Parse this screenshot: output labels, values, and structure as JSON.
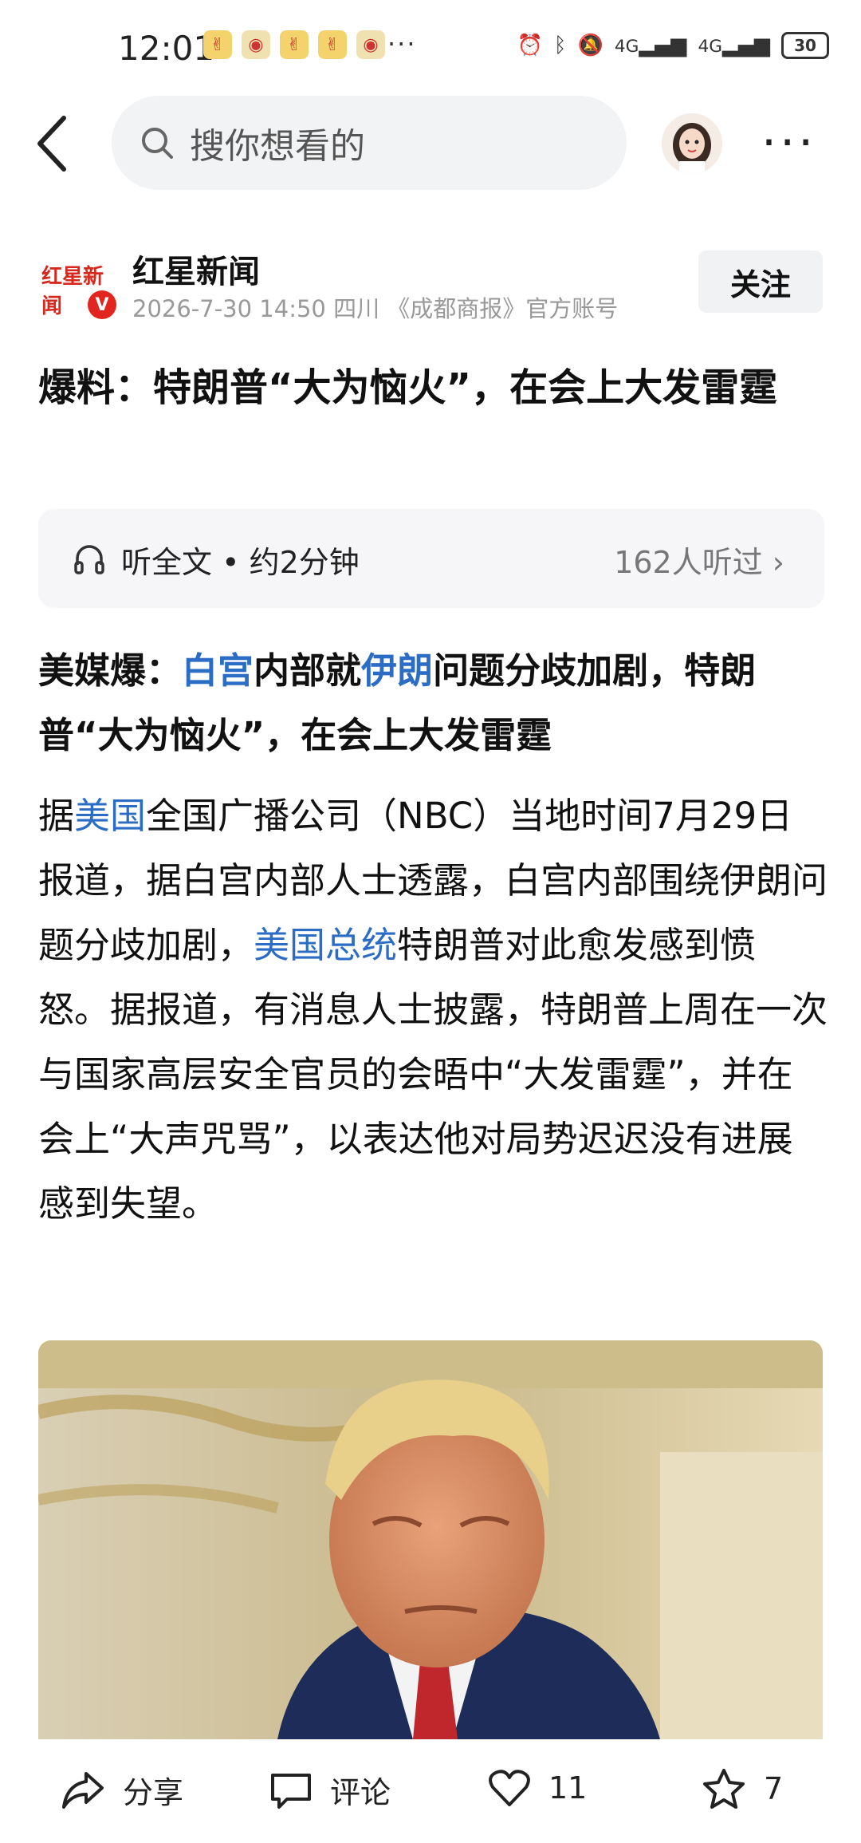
{
  "status": {
    "time": "12:01",
    "battery": "30",
    "more": "···",
    "signal1": "4G",
    "signal2": "4G"
  },
  "search": {
    "placeholder": "搜你想看的"
  },
  "author": {
    "logo_text": "红星新闻",
    "name": "红星新闻",
    "meta": "2026-7-30  14:50  四川 《成都商报》官方账号",
    "follow": "关注",
    "verify": "V"
  },
  "article": {
    "title": "爆料：特朗普“大为恼火”，在会上大发雷霆",
    "listen_label": "听全文 • 约2分钟",
    "listen_count": "162人听过",
    "lead": [
      {
        "t": "美媒爆：",
        "link": false
      },
      {
        "t": "白宫",
        "link": true
      },
      {
        "t": "内部就",
        "link": false
      },
      {
        "t": "伊朗",
        "link": true
      },
      {
        "t": "问题分歧加剧，特朗普“大为恼火”，在会上大发雷霆",
        "link": false
      }
    ],
    "body": [
      {
        "t": "据",
        "link": false
      },
      {
        "t": "美国",
        "link": true
      },
      {
        "t": "全国广播公司（NBC）当地时间7月29日报道，据白宫内部人士透露，白宫内部围绕伊朗问题分歧加剧，",
        "link": false
      },
      {
        "t": "美国总统",
        "link": true
      },
      {
        "t": "特朗普对此愈发感到愤怒。据报道，有消息人士披露，特朗普上周在一次与国家高层安全官员的会晤中“大发雷霆”，并在会上“大声咒骂”，以表达他对局势迟迟没有进展感到失望。",
        "link": false
      }
    ]
  },
  "bottom_bar": {
    "share": "分享",
    "comment": "评论",
    "likes": "11",
    "stars": "7"
  }
}
